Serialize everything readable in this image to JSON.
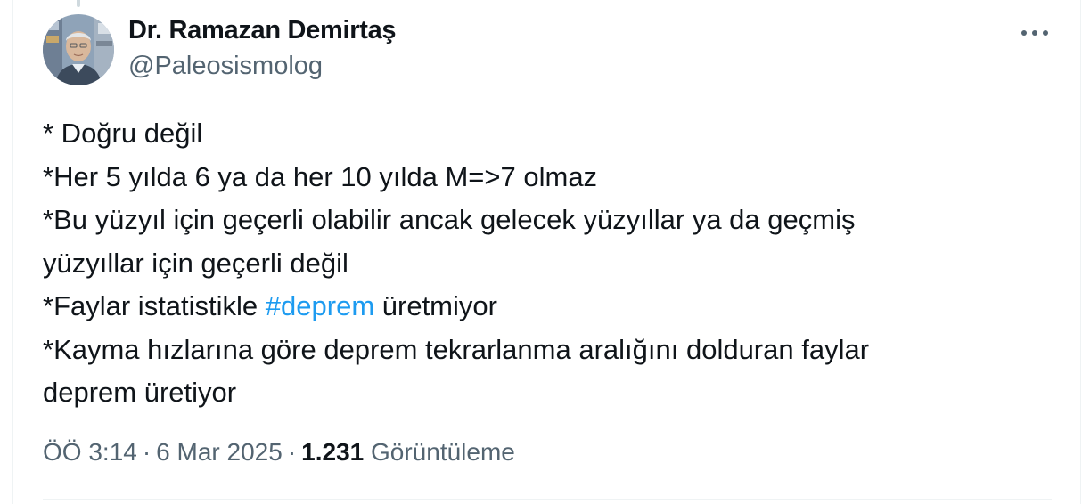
{
  "author": {
    "display_name": "Dr. Ramazan Demirtaş",
    "handle": "@Paleosismolog"
  },
  "post": {
    "lines": [
      "* Doğru değil",
      "*Her 5 yılda 6 ya da her 10 yılda M=>7 olmaz",
      "*Bu yüzyıl için geçerli olabilir ancak gelecek yüzyıllar ya da geçmiş",
      "yüzyıllar için geçerli değil"
    ],
    "fault_line": {
      "before": "*Faylar istatistikle ",
      "hashtag": "#deprem",
      "after": " üretmiyor"
    },
    "closing_lines": [
      "*Kayma hızlarına göre deprem tekrarlanma aralığını dolduran faylar",
      "deprem üretiyor"
    ]
  },
  "meta": {
    "time": "ÖÖ 3:14",
    "separator": "·",
    "date": "6 Mar 2025",
    "views_count": "1.231",
    "views_label": "Görüntüleme"
  },
  "icons": {
    "more": "more-horizontal-icon"
  },
  "colors": {
    "text": "#0f1419",
    "secondary": "#536471",
    "link": "#1d9bf0",
    "border": "#eff3f4"
  }
}
